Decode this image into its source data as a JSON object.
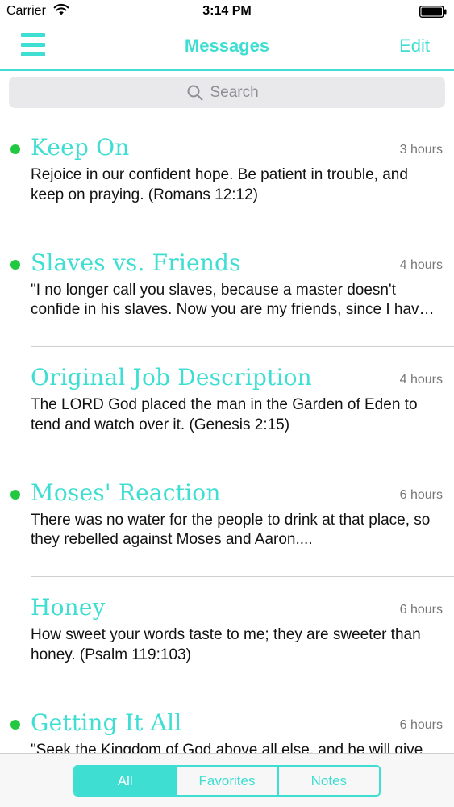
{
  "status_bar": {
    "carrier": "Carrier",
    "time": "3:14 PM",
    "wifi_icon": "wifi-icon",
    "battery_icon": "battery-icon"
  },
  "nav": {
    "menu_icon": "hamburger-menu-icon",
    "title": "Messages",
    "edit_label": "Edit"
  },
  "search": {
    "placeholder": "Search",
    "icon": "search-icon"
  },
  "messages": [
    {
      "title": "Keep On",
      "time": "3 hours",
      "unread": true,
      "body": "Rejoice in our confident hope. Be patient in trouble, and keep on praying. (Romans 12:12)"
    },
    {
      "title": "Slaves vs. Friends",
      "time": "4 hours",
      "unread": true,
      "body": "\"I no longer call you slaves, because a master doesn't confide in his slaves. Now you are my friends, since I have told you everything the Father told me.\""
    },
    {
      "title": "Original Job Description",
      "time": "4 hours",
      "unread": false,
      "body": "The LORD God placed the man in the Garden of Eden to tend and watch over it. (Genesis 2:15)"
    },
    {
      "title": "Moses' Reaction",
      "time": "6 hours",
      "unread": true,
      "body": "There was no water for the people to drink at that place, so they rebelled against Moses and Aaron...."
    },
    {
      "title": "Honey",
      "time": "6 hours",
      "unread": false,
      "body": "How sweet your words taste to me; they are sweeter than honey. (Psalm 119:103)"
    },
    {
      "title": "Getting It All",
      "time": "6 hours",
      "unread": true,
      "body": "\"Seek the Kingdom of God above all else, and he will give"
    }
  ],
  "tabs": {
    "items": [
      {
        "label": "All",
        "active": true
      },
      {
        "label": "Favorites",
        "active": false
      },
      {
        "label": "Notes",
        "active": false
      }
    ]
  },
  "colors": {
    "accent": "#3fded2",
    "unread_dot": "#22c940",
    "search_bg": "#e9e9ec",
    "separator": "#cfcfd2"
  }
}
